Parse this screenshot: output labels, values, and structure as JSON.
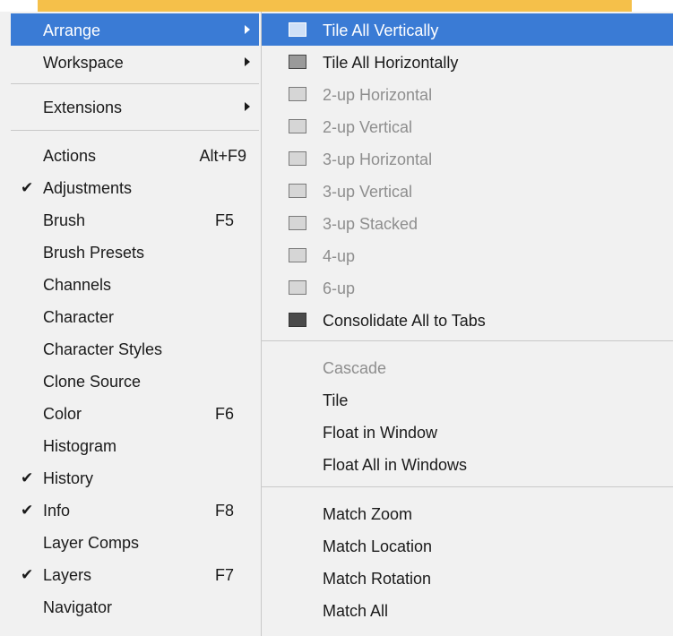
{
  "main_menu": {
    "arrange": {
      "label": "Arrange"
    },
    "workspace": {
      "label": "Workspace"
    },
    "extensions": {
      "label": "Extensions"
    },
    "actions": {
      "label": "Actions",
      "shortcut": "Alt+F9"
    },
    "adjustments": {
      "label": "Adjustments",
      "check": "✔"
    },
    "brush": {
      "label": "Brush",
      "shortcut": "F5"
    },
    "brush_presets": {
      "label": "Brush Presets"
    },
    "channels": {
      "label": "Channels"
    },
    "character": {
      "label": "Character"
    },
    "character_styles": {
      "label": "Character Styles"
    },
    "clone_source": {
      "label": "Clone Source"
    },
    "color": {
      "label": "Color",
      "shortcut": "F6"
    },
    "histogram": {
      "label": "Histogram"
    },
    "history": {
      "label": "History",
      "check": "✔"
    },
    "info": {
      "label": "Info",
      "shortcut": "F8",
      "check": "✔"
    },
    "layer_comps": {
      "label": "Layer Comps"
    },
    "layers": {
      "label": "Layers",
      "shortcut": "F7",
      "check": "✔"
    },
    "navigator": {
      "label": "Navigator"
    }
  },
  "arrange_submenu": {
    "tile_all_vertically": "Tile All Vertically",
    "tile_all_horizontally": "Tile All Horizontally",
    "two_up_horizontal": "2-up Horizontal",
    "two_up_vertical": "2-up Vertical",
    "three_up_horizontal": "3-up Horizontal",
    "three_up_vertical": "3-up Vertical",
    "three_up_stacked": "3-up Stacked",
    "four_up": "4-up",
    "six_up": "6-up",
    "consolidate_all_to_tabs": "Consolidate All to Tabs",
    "cascade": "Cascade",
    "tile": "Tile",
    "float_in_window": "Float in Window",
    "float_all_in_windows": "Float All in Windows",
    "match_zoom": "Match Zoom",
    "match_location": "Match Location",
    "match_rotation": "Match Rotation",
    "match_all": "Match All"
  },
  "colors": {
    "highlight": "#3a7bd5",
    "menu_bg": "#f1f1f1",
    "top_bar": "#f5c04a",
    "disabled_text": "#8e8e8e"
  }
}
